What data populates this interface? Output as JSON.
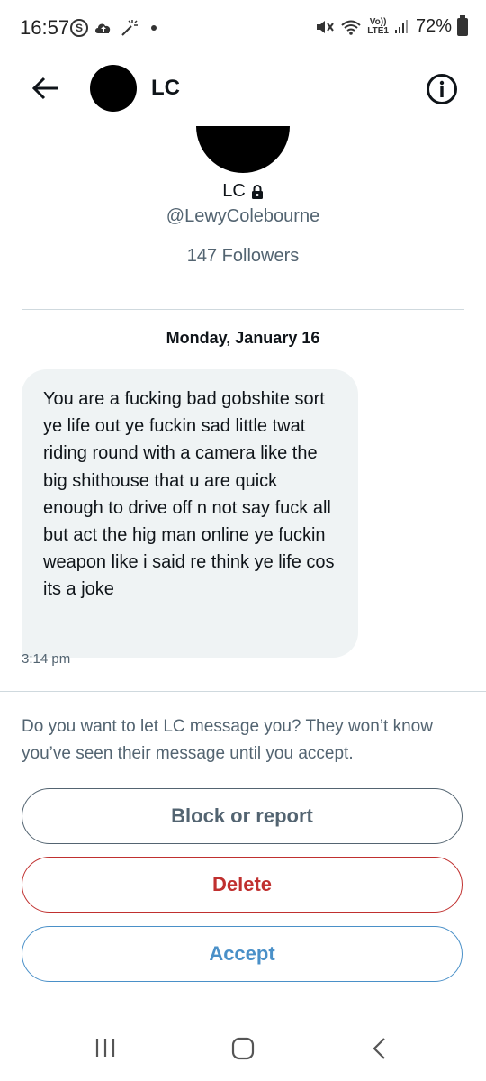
{
  "status_bar": {
    "time": "16:57",
    "battery": "72%",
    "network": "LTE1",
    "volte": "Vo))",
    "icons": [
      "skype-icon",
      "cloud-upload-icon",
      "magic-wand-icon",
      "dot-icon",
      "mute-icon",
      "wifi-icon",
      "volte-icon",
      "signal-icon",
      "battery-icon"
    ]
  },
  "header": {
    "title": "LC",
    "icons": [
      "back-arrow-icon",
      "info-icon"
    ]
  },
  "profile": {
    "name": "LC",
    "handle": "@LewyColebourne",
    "followers": "147 Followers",
    "locked": true
  },
  "conversation": {
    "date": "Monday, January 16",
    "messages": [
      {
        "text": "You are a fucking bad gobshite sort ye life out ye fuckin sad little twat riding round with a camera like the big shithouse that u are quick enough to drive off n not say fuck all but act the hig man online ye fuckin weapon like i said re think ye life cos its a joke",
        "time": "3:14 pm"
      }
    ]
  },
  "request": {
    "prompt": "Do you want to let LC message you? They won’t know you’ve seen their message until you accept.",
    "block_label": "Block or report",
    "delete_label": "Delete",
    "accept_label": "Accept"
  },
  "colors": {
    "text_primary": "#0f1419",
    "text_secondary": "#536471",
    "bubble_bg": "#eff3f4",
    "delete_red": "#c0302f",
    "accept_blue": "#4a90c8",
    "divider": "#cfd9de"
  }
}
